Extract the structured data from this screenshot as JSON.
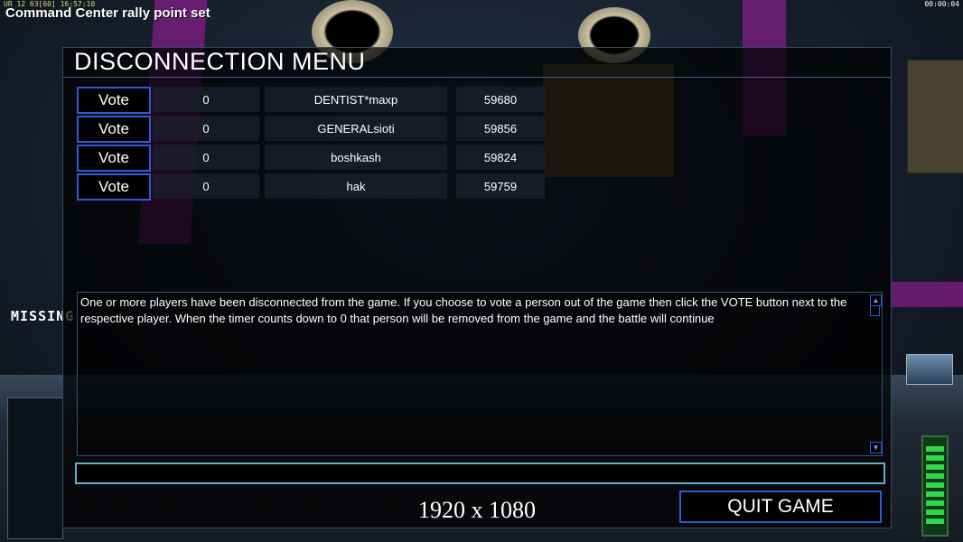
{
  "hud": {
    "top_left_info": "UR 12 63[60] 16:57:10",
    "top_right_clock": "00:00:04",
    "status_message": "Command Center rally point set",
    "missing_text": "MISSING"
  },
  "menu": {
    "title": "DISCONNECTION MENU",
    "vote_label": "Vote",
    "players": [
      {
        "votes": "0",
        "name": "DENTIST*maxp",
        "ping": "59680"
      },
      {
        "votes": "0",
        "name": "GENERALsioti",
        "ping": "59856"
      },
      {
        "votes": "0",
        "name": "boshkash",
        "ping": "59824"
      },
      {
        "votes": "0",
        "name": "hak",
        "ping": "59759"
      }
    ],
    "message": "One or more players have been disconnected from the game. If you choose to vote a person out of the game then click the VOTE button next to the respective player. When the timer counts down to 0 that person will be removed from the game and the battle will continue",
    "chat_value": "",
    "quit_label": "QUIT GAME"
  },
  "overlay": {
    "resolution": "1920 x 1080"
  },
  "colors": {
    "button_border": "#2d5bd6",
    "input_border": "#5fb0c8",
    "energy_green": "#2ed84a",
    "stripe_magenta": "#aa1eaa"
  }
}
